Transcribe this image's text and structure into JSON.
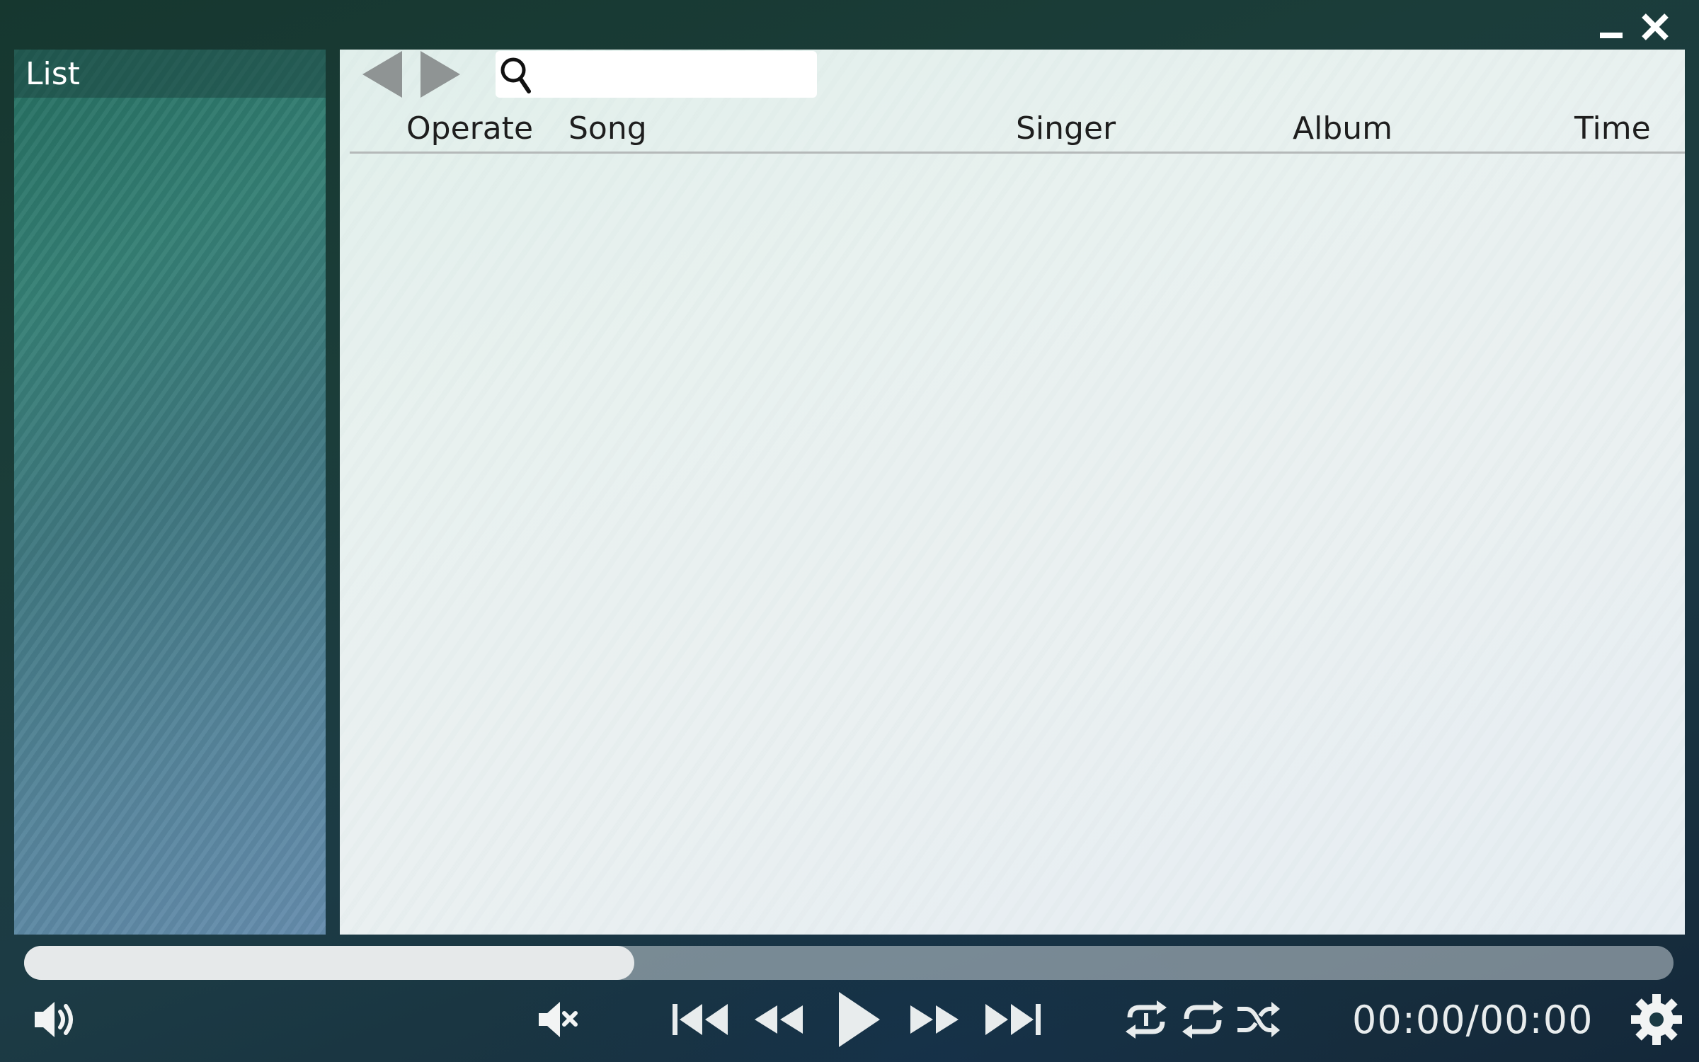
{
  "window": {
    "minimize_icon": "minimize-icon",
    "close_icon": "close-icon"
  },
  "sidebar": {
    "title": "List"
  },
  "toolbar": {
    "back_icon": "left-triangle-icon",
    "forward_icon": "right-triangle-icon",
    "search": {
      "icon": "search-icon",
      "value": "",
      "placeholder": ""
    }
  },
  "table": {
    "columns": [
      "Operate",
      "Song",
      "Singer",
      "Album",
      "Time"
    ],
    "rows": []
  },
  "player": {
    "progress_fraction": 0.37,
    "time": "00:00/00:00",
    "controls": {
      "volume_icon": "volume-icon",
      "mute_icon": "mute-icon",
      "first_icon": "skip-to-start-icon",
      "rewind_icon": "rewind-icon",
      "play_icon": "play-icon",
      "fast_forward_icon": "fast-forward-icon",
      "last_icon": "skip-to-end-icon",
      "repeat_one_icon": "repeat-one-icon",
      "repeat_icon": "repeat-icon",
      "shuffle_icon": "shuffle-icon",
      "settings_icon": "gear-icon"
    }
  },
  "colors": {
    "main_panel": "#e6efee",
    "progress_fill": "#e6e9ea",
    "icon_light": "#e8eced",
    "icon_dark": "#222222"
  }
}
